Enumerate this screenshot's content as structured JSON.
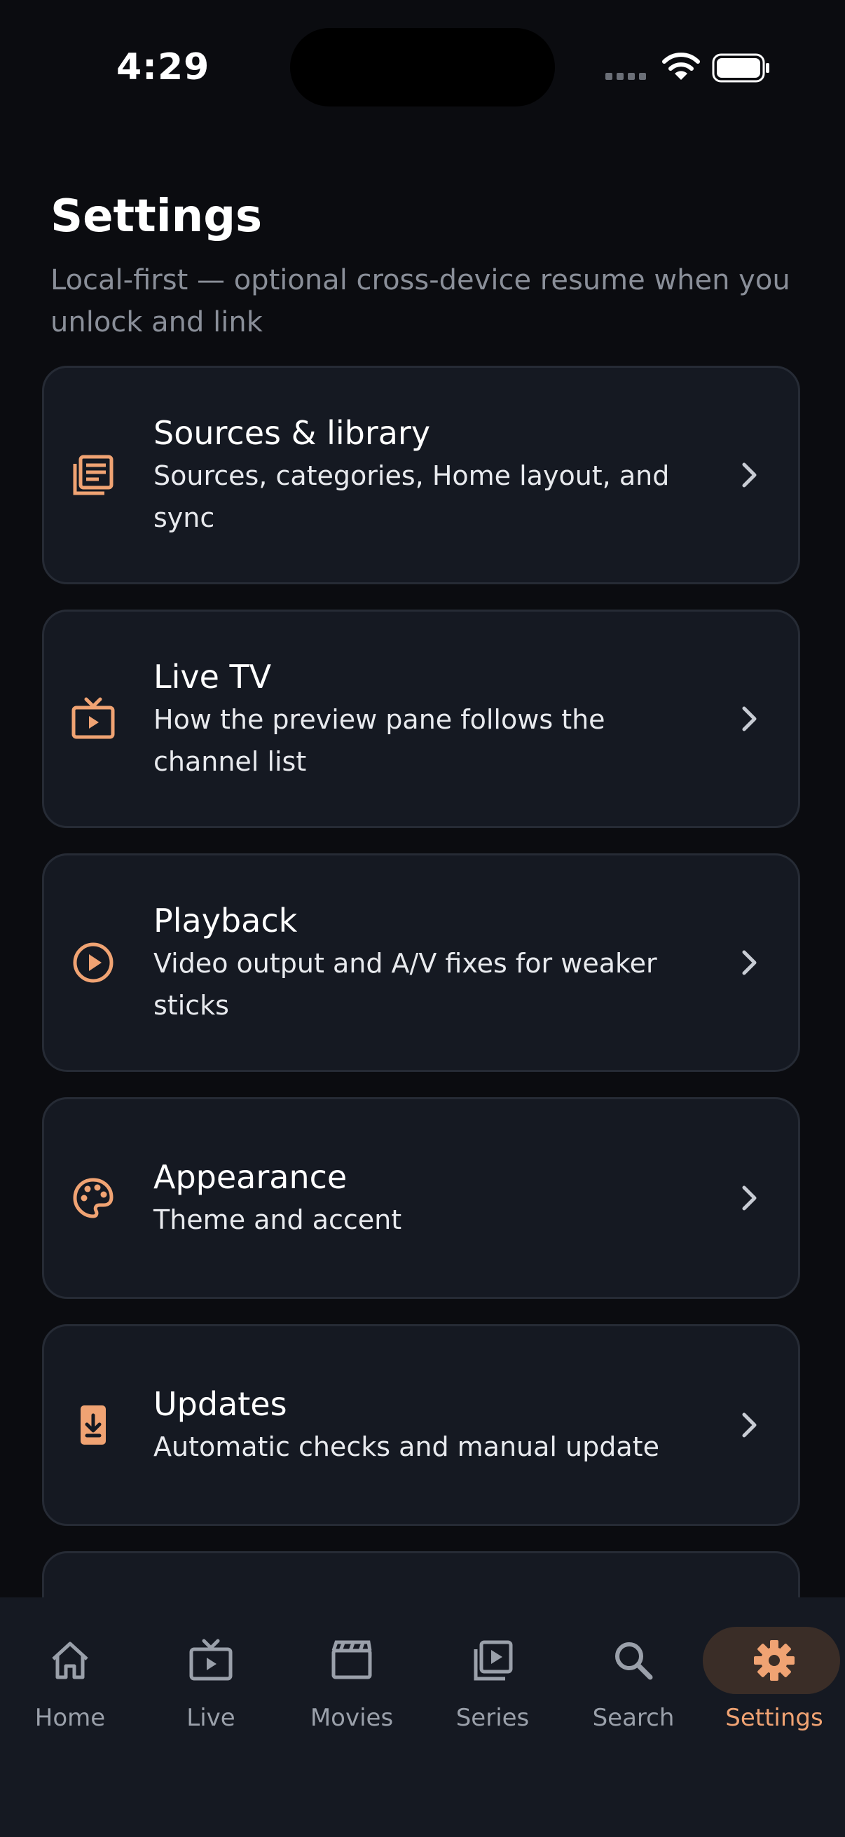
{
  "status": {
    "time": "4:29"
  },
  "header": {
    "title": "Settings",
    "subtitle": "Local-first — optional cross-device resume when you unlock and link"
  },
  "items": [
    {
      "label": "Sources & library",
      "desc": "Sources, categories, Home layout, and sync",
      "icon": "library-icon"
    },
    {
      "label": "Live TV",
      "desc": "How the preview pane follows the channel list",
      "icon": "tv-icon"
    },
    {
      "label": "Playback",
      "desc": "Video output and A/V fixes for weaker sticks",
      "icon": "play-circle-icon"
    },
    {
      "label": "Appearance",
      "desc": "Theme and accent",
      "icon": "palette-icon"
    },
    {
      "label": "Updates",
      "desc": "Automatic checks and manual update",
      "icon": "update-icon"
    }
  ],
  "nav": [
    {
      "label": "Home",
      "icon": "home-icon"
    },
    {
      "label": "Live",
      "icon": "live-tv-icon"
    },
    {
      "label": "Movies",
      "icon": "clapperboard-icon"
    },
    {
      "label": "Series",
      "icon": "series-icon"
    },
    {
      "label": "Search",
      "icon": "search-icon"
    },
    {
      "label": "Settings",
      "icon": "gear-icon",
      "active": true
    }
  ],
  "colors": {
    "background": "#0b0c10",
    "card": "#151922",
    "card_border": "#262b35",
    "accent": "#f0a373",
    "muted_text": "#8a8f99",
    "nav_active_pill": "#3a2d27"
  }
}
